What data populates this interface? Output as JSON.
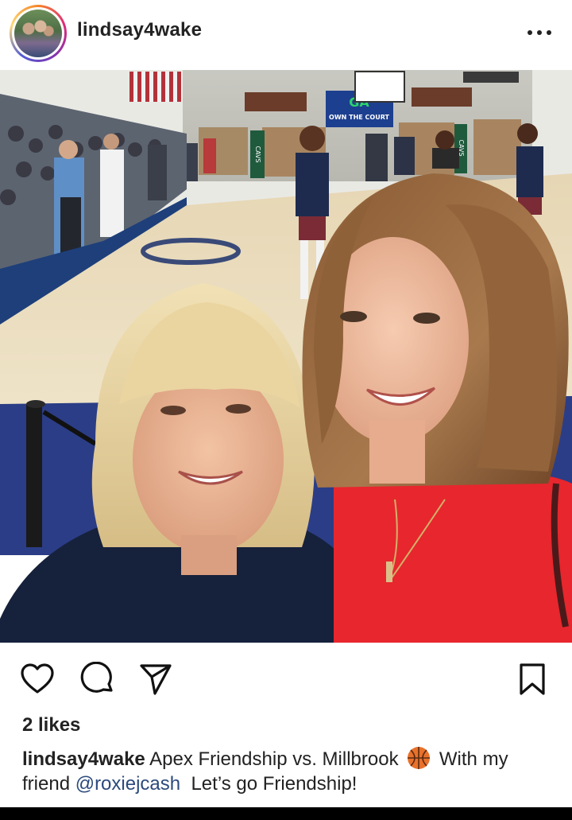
{
  "post": {
    "username": "lindsay4wake",
    "likes": "2 likes",
    "caption": {
      "username": "lindsay4wake",
      "text_before_emoji": " Apex Friendship vs. Millbrook ",
      "emoji": "basketball-emoji",
      "text_after_emoji": " With my friend ",
      "mention": "@roxiejcash",
      "text_end": "  Let’s go Friendship!"
    }
  },
  "photo": {
    "banner_text": "GA",
    "banner_subtext": "OWN THE COURT",
    "side_sign_left": "CAVS",
    "side_sign_right": "CAVS"
  },
  "icons": {
    "more": "more-options-icon",
    "like": "heart-icon",
    "comment": "comment-icon",
    "share": "send-icon",
    "save": "bookmark-icon"
  },
  "colors": {
    "text": "#222222",
    "mention": "#2b4a7d",
    "jersey_red": "#e8262d",
    "shirt_navy": "#16213b"
  }
}
